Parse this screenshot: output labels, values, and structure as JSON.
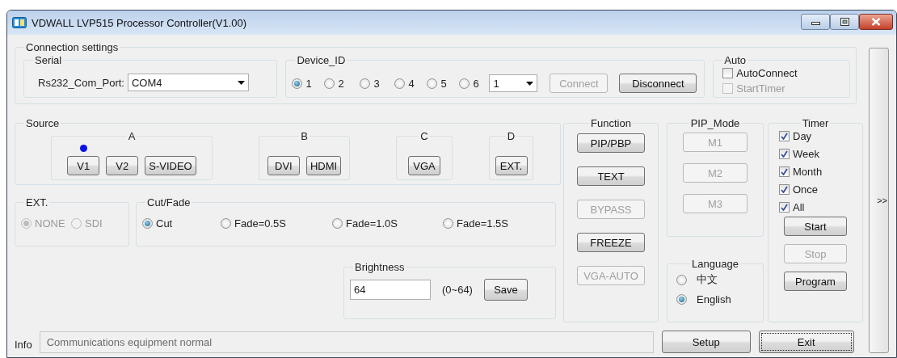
{
  "window": {
    "title": "VDWALL LVP515 Processor Controller(V1.00)"
  },
  "connection_settings": {
    "title": "Connection settings",
    "serial": {
      "title": "Serial",
      "label": "Rs232_Com_Port:",
      "value": "COM4"
    },
    "device_id": {
      "title": "Device_ID",
      "options": [
        {
          "label": "1",
          "selected": true
        },
        {
          "label": "2",
          "selected": false
        },
        {
          "label": "3",
          "selected": false
        },
        {
          "label": "4",
          "selected": false
        },
        {
          "label": "5",
          "selected": false
        },
        {
          "label": "6",
          "selected": false
        }
      ],
      "dropdown_value": "1",
      "buttons": [
        {
          "label": "Connect",
          "disabled": true
        },
        {
          "label": "Disconnect",
          "disabled": false
        }
      ]
    },
    "auto": {
      "title": "Auto",
      "options": [
        {
          "label": "AutoConnect",
          "checked": false,
          "disabled": false
        },
        {
          "label": "StartTimer",
          "checked": false,
          "disabled": true
        }
      ]
    }
  },
  "source": {
    "title": "Source",
    "groups": [
      {
        "label": "A",
        "buttons": [
          {
            "label": "V1",
            "active": true
          },
          {
            "label": "V2",
            "active": false
          },
          {
            "label": "S-VIDEO",
            "active": false
          }
        ]
      },
      {
        "label": "B",
        "buttons": [
          {
            "label": "DVI",
            "active": false
          },
          {
            "label": "HDMI",
            "active": false
          }
        ]
      },
      {
        "label": "C",
        "buttons": [
          {
            "label": "VGA",
            "active": false
          }
        ]
      },
      {
        "label": "D",
        "buttons": [
          {
            "label": "EXT.",
            "active": false
          }
        ]
      }
    ]
  },
  "ext": {
    "title": "EXT.",
    "options": [
      {
        "label": "NONE",
        "selected": true,
        "disabled": true
      },
      {
        "label": "SDI",
        "selected": false,
        "disabled": true
      }
    ]
  },
  "cut_fade": {
    "title": "Cut/Fade",
    "options": [
      {
        "label": "Cut",
        "selected": true
      },
      {
        "label": "Fade=0.5S",
        "selected": false
      },
      {
        "label": "Fade=1.0S",
        "selected": false
      },
      {
        "label": "Fade=1.5S",
        "selected": false
      }
    ]
  },
  "brightness": {
    "title": "Brightness",
    "value": "64",
    "range": "(0~64)",
    "button": "Save"
  },
  "function": {
    "title": "Function",
    "buttons": [
      {
        "label": "PIP/PBP",
        "disabled": false
      },
      {
        "label": "TEXT",
        "disabled": false
      },
      {
        "label": "BYPASS",
        "disabled": true
      },
      {
        "label": "FREEZE",
        "disabled": false
      },
      {
        "label": "VGA-AUTO",
        "disabled": true
      }
    ]
  },
  "pip_mode": {
    "title": "PIP_Mode",
    "buttons": [
      {
        "label": "M1",
        "disabled": true
      },
      {
        "label": "M2",
        "disabled": true
      },
      {
        "label": "M3",
        "disabled": true
      }
    ]
  },
  "language": {
    "title": "Language",
    "options": [
      {
        "label": "中文",
        "selected": false
      },
      {
        "label": "English",
        "selected": true
      }
    ]
  },
  "timer": {
    "title": "Timer",
    "options": [
      {
        "label": "Day",
        "checked": true
      },
      {
        "label": "Week",
        "checked": true
      },
      {
        "label": "Month",
        "checked": true
      },
      {
        "label": "Once",
        "checked": true
      },
      {
        "label": "All",
        "checked": true
      }
    ],
    "buttons": [
      {
        "label": "Start",
        "disabled": false
      },
      {
        "label": "Stop",
        "disabled": true
      },
      {
        "label": "Program",
        "disabled": false
      }
    ]
  },
  "info": {
    "label": "Info",
    "value": "Communications equipment normal"
  },
  "buttons": [
    {
      "label": "Setup",
      "focused": false
    },
    {
      "label": "Exit",
      "focused": true
    }
  ],
  "side_button": {
    "label": ">>"
  }
}
